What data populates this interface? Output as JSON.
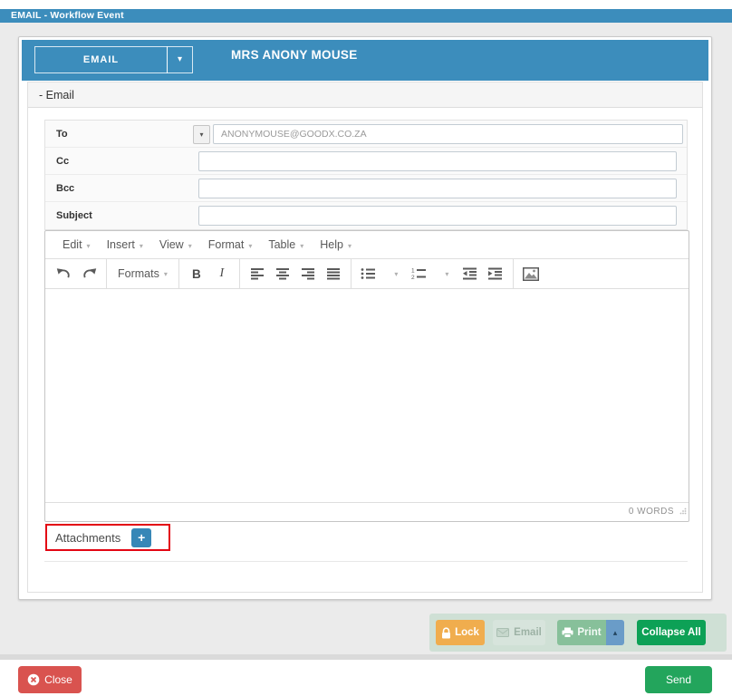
{
  "window_title": "EMAIL - Workflow Event",
  "header": {
    "type_button_label": "EMAIL",
    "patient_name": "MRS ANONY MOUSE"
  },
  "section_title": "- Email",
  "fields": {
    "to_label": "To",
    "to_value": "ANONYMOUSE@GOODX.CO.ZA",
    "cc_label": "Cc",
    "bcc_label": "Bcc",
    "subject_label": "Subject"
  },
  "editor": {
    "menu": [
      "Edit",
      "Insert",
      "View",
      "Format",
      "Table",
      "Help"
    ],
    "formats_label": "Formats",
    "bold_label": "B",
    "italic_label": "I",
    "word_count": "0 WORDS"
  },
  "attachments": {
    "label": "Attachments",
    "add_button": "+"
  },
  "action_bar": {
    "lock_label": "Lock",
    "email_label": "Email",
    "print_label": "Print",
    "collapse_label": "Collapse All"
  },
  "footer": {
    "close_label": "Close",
    "send_label": "Send"
  },
  "icons": {
    "caret_down": "▾",
    "caret_up": "▴",
    "undo": "curved-arrow-left",
    "redo": "curved-arrow-right",
    "align": "text-align-bars",
    "bullet_list": "dotted-list",
    "numbered_list": "numbered-list",
    "outdent": "left-arrow-bars",
    "indent": "right-arrow-bars",
    "image": "picture-frame",
    "lock": "padlock",
    "email": "envelope",
    "print": "printer",
    "close": "circled-x"
  },
  "colors": {
    "header_blue": "#3c8dbc",
    "highlight_red": "#e30613",
    "lock_orange": "#f0ad4e",
    "print_green": "#87c09a",
    "print_caret_blue": "#6a9cc8",
    "collapse_green": "#0da156",
    "close_red": "#d9534f",
    "send_green": "#23a55c",
    "attach_button_blue": "#3787b7",
    "action_bar_bg": "#cfe0d5"
  }
}
